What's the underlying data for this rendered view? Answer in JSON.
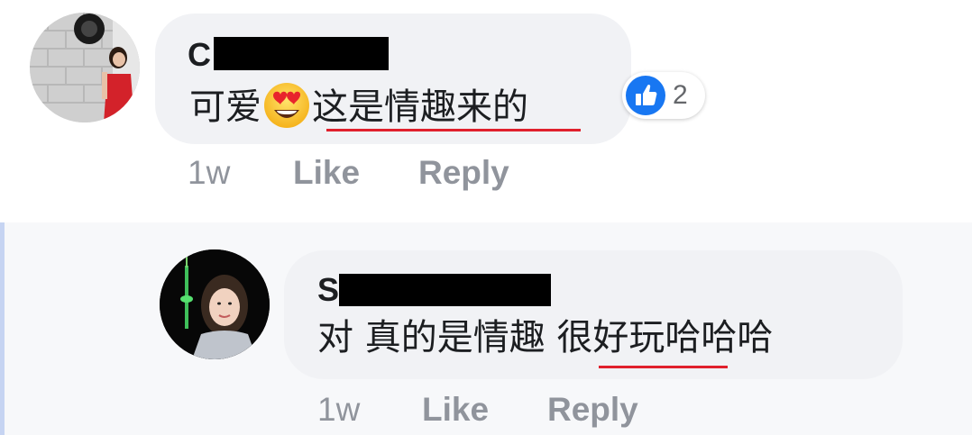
{
  "comments": [
    {
      "author_initial": "C",
      "text_before_emoji": "可爱",
      "emoji": "heart-eyes-emoji",
      "text_after_emoji": "这是情趣来的",
      "reaction_count": "2",
      "time": "1w",
      "like_label": "Like",
      "reply_label": "Reply"
    }
  ],
  "replies": [
    {
      "author_initial": "S",
      "text": "对 真的是情趣 很好玩哈哈哈",
      "time": "1w",
      "like_label": "Like",
      "reply_label": "Reply"
    }
  ],
  "colors": {
    "bubble": "#f1f2f5",
    "meta_text": "#90949c",
    "underline": "#e0202c",
    "like_blue": "#1877f2",
    "reply_bar": "#c6d4f2"
  }
}
